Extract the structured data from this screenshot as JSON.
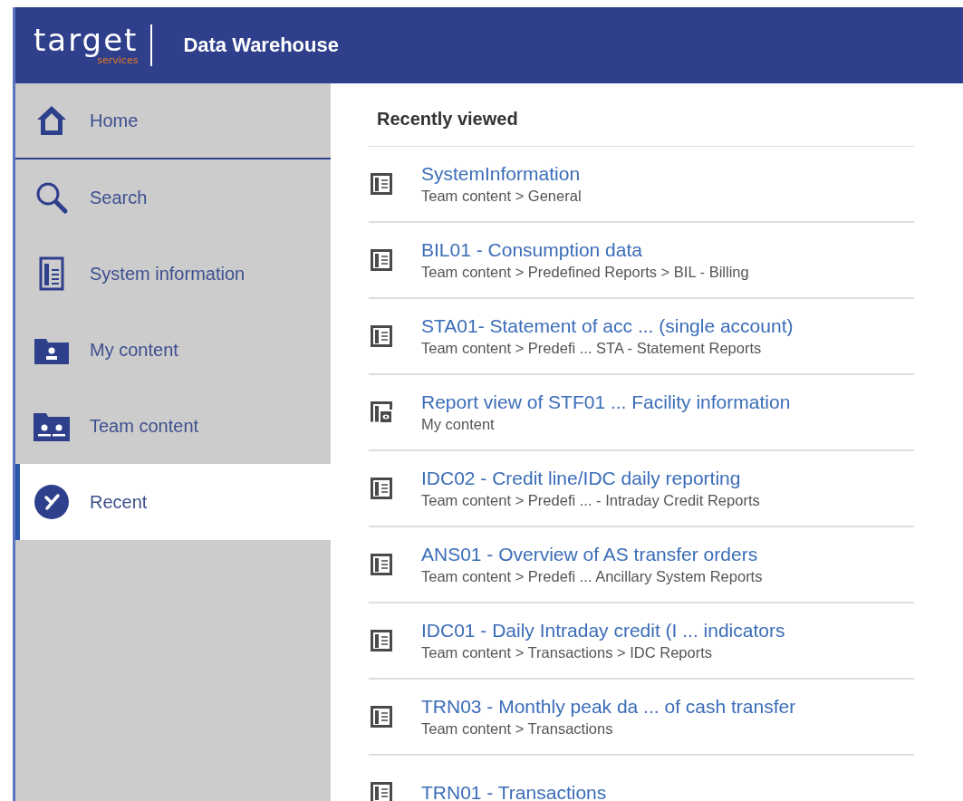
{
  "header": {
    "logo_word": "target",
    "logo_sub": "services",
    "title": "Data Warehouse"
  },
  "sidebar": {
    "items": [
      {
        "label": "Home",
        "kind": "home",
        "selected": false
      },
      {
        "label": "Search",
        "kind": "search",
        "selected": false
      },
      {
        "label": "System information",
        "kind": "report",
        "selected": false
      },
      {
        "label": "My content",
        "kind": "folder-person",
        "selected": false
      },
      {
        "label": "Team content",
        "kind": "folder-people",
        "selected": false
      },
      {
        "label": "Recent",
        "kind": "clock",
        "selected": true
      }
    ]
  },
  "recent": {
    "heading": "Recently viewed",
    "items": [
      {
        "kind": "report",
        "title": "SystemInformation",
        "path": "Team content > General"
      },
      {
        "kind": "report",
        "title": "BIL01 - Consumption data",
        "path": "Team content > Predefined Reports > BIL - Billing"
      },
      {
        "kind": "report",
        "title": "STA01- Statement of acc ... (single account)",
        "path": "Team content > Predefi ... STA - Statement Reports"
      },
      {
        "kind": "report-view",
        "title": "Report view of STF01 ... Facility information",
        "path": "My content"
      },
      {
        "kind": "report",
        "title": "IDC02 - Credit line/IDC daily reporting",
        "path": "Team content > Predefi ... - Intraday Credit Reports"
      },
      {
        "kind": "report",
        "title": "ANS01 - Overview of AS transfer orders",
        "path": "Team content > Predefi ... Ancillary System Reports"
      },
      {
        "kind": "report",
        "title": "IDC01 - Daily Intraday credit (I ... indicators",
        "path": "Team content > Transactions > IDC Reports"
      },
      {
        "kind": "report",
        "title": "TRN03 - Monthly peak da ... of cash transfer",
        "path": "Team content > Transactions"
      },
      {
        "kind": "report",
        "title": "TRN01 - Transactions"
      }
    ]
  }
}
